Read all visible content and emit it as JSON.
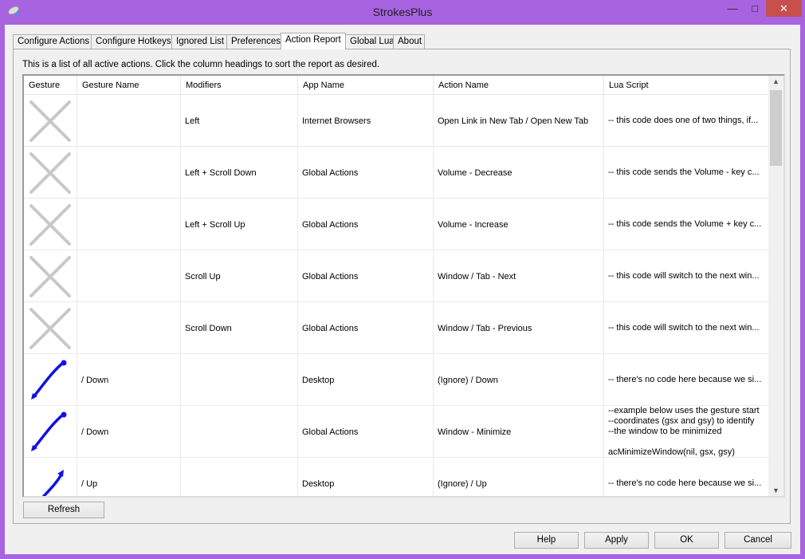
{
  "window": {
    "title": "StrokesPlus",
    "close_color": "#c7504c",
    "border_color": "#a763e0"
  },
  "tabs": [
    "Configure Actions",
    "Configure Hotkeys",
    "Ignored List",
    "Preferences",
    "Action Report",
    "Global Lua",
    "About"
  ],
  "active_tab": "Action Report",
  "description": "This is a list of all active actions.  Click the column headings to sort the report as desired.",
  "columns": [
    "Gesture",
    "Gesture Name",
    "Modifiers",
    "App Name",
    "Action Name",
    "Lua Script"
  ],
  "rows": [
    {
      "gesture_icon": "x-gesture-icon",
      "gesture_name": "",
      "modifiers": "Left",
      "app": "Internet Browsers",
      "action": "Open Link in New Tab / Open New Tab",
      "lua": "-- this code does one of two things, if..."
    },
    {
      "gesture_icon": "x-gesture-icon",
      "gesture_name": "",
      "modifiers": "Left + Scroll Down",
      "app": "Global Actions",
      "action": "Volume - Decrease",
      "lua": "-- this code sends the Volume - key c..."
    },
    {
      "gesture_icon": "x-gesture-icon",
      "gesture_name": "",
      "modifiers": "Left + Scroll Up",
      "app": "Global Actions",
      "action": "Volume - Increase",
      "lua": "-- this code sends the Volume + key c..."
    },
    {
      "gesture_icon": "x-gesture-icon",
      "gesture_name": "",
      "modifiers": "Scroll Up",
      "app": "Global Actions",
      "action": "Window / Tab - Next",
      "lua": "-- this code will switch to the next win..."
    },
    {
      "gesture_icon": "x-gesture-icon",
      "gesture_name": "",
      "modifiers": "Scroll Down",
      "app": "Global Actions",
      "action": "Window / Tab - Previous",
      "lua": "-- this code will switch to the next win..."
    },
    {
      "gesture_icon": "down-stroke-icon",
      "gesture_name": "/ Down",
      "modifiers": "",
      "app": "Desktop",
      "action": "(Ignore) / Down",
      "lua": "-- there's no code here because we si..."
    },
    {
      "gesture_icon": "down-stroke-icon",
      "gesture_name": "/ Down",
      "modifiers": "",
      "app": "Global Actions",
      "action": "Window - Minimize",
      "lua": "--example below uses the gesture start\n--coordinates (gsx and gsy) to identify\n--the window to be minimized\n\nacMinimizeWindow(nil, gsx, gsy)"
    },
    {
      "gesture_icon": "up-stroke-icon",
      "gesture_name": "/ Up",
      "modifiers": "",
      "app": "Desktop",
      "action": "(Ignore) / Up",
      "lua": "-- there's no code here because we si..."
    }
  ],
  "buttons": {
    "refresh": "Refresh",
    "help": "Help",
    "apply": "Apply",
    "ok": "OK",
    "cancel": "Cancel"
  }
}
